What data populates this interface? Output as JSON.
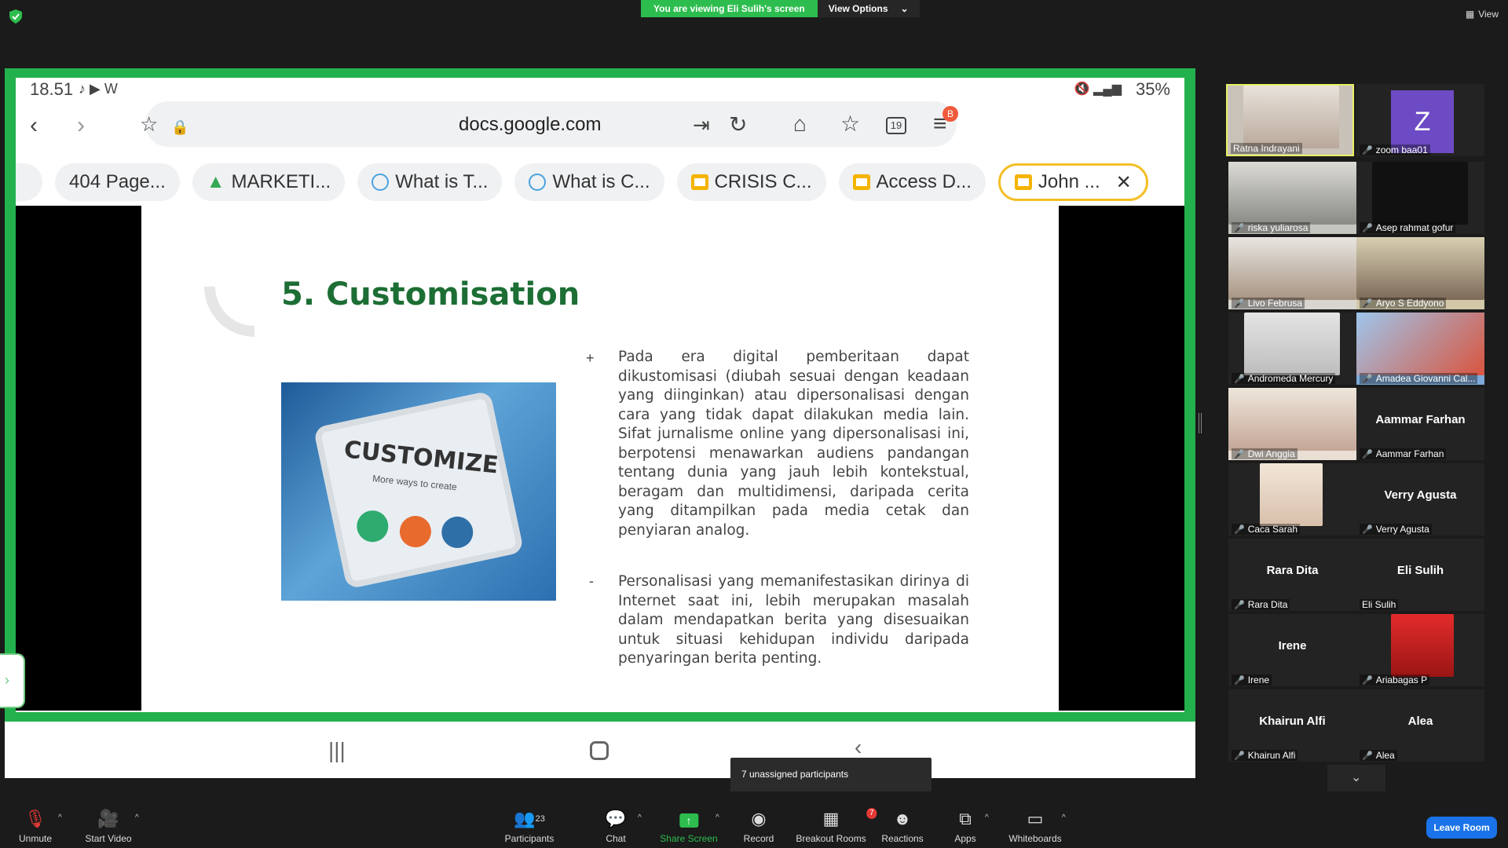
{
  "top": {
    "banner_text": "You are viewing Eli Sulih's screen",
    "view_options": "View Options",
    "view_label": "View"
  },
  "phone": {
    "time": "18.51",
    "battery": "35%",
    "url": "docs.google.com",
    "tabs": [
      {
        "label": "404 Page..."
      },
      {
        "label": "MARKETI..."
      },
      {
        "label": "What is T..."
      },
      {
        "label": "What is C..."
      },
      {
        "label": "CRISIS C..."
      },
      {
        "label": "Access D..."
      },
      {
        "label": "John ..."
      }
    ],
    "menu_badge": "B",
    "tab_count": "19"
  },
  "slide": {
    "title": "5. Customisation",
    "image_text": "CUSTOMIZE",
    "image_subtext": "More ways to create",
    "bullet1": "+",
    "para1": "Pada era digital pemberitaan dapat dikustomisasi (diubah sesuai dengan keadaan yang diinginkan) atau dipersonalisasi dengan cara yang tidak dapat dilakukan media lain. Sifat jurnalisme online yang dipersonalisasi ini, berpotensi menawarkan audiens pandangan tentang dunia yang jauh lebih kontekstual, beragam dan multidimensi, daripada cerita yang ditampilkan pada media cetak dan penyiaran analog.",
    "bullet2": "-",
    "para2": "Personalisasi yang memanifestasikan dirinya di Internet saat ini, lebih merupakan masalah dalam mendapatkan berita yang disesuaikan untuk situasi kehidupan individu daripada penyaringan berita penting."
  },
  "participants": [
    {
      "name": "Ratna Indrayani",
      "big": ""
    },
    {
      "name": "zoom baa01",
      "big": "Z"
    },
    {
      "name": "riska yuliarosa",
      "big": ""
    },
    {
      "name": "Asep rahmat gofur",
      "big": ""
    },
    {
      "name": "Livo Februsa",
      "big": ""
    },
    {
      "name": "Aryo S Eddyono",
      "big": ""
    },
    {
      "name": "Andromeda Mercury",
      "big": ""
    },
    {
      "name": "Amadea Giovanni Cal...",
      "big": ""
    },
    {
      "name": "Dwi Anggia",
      "big": ""
    },
    {
      "name": "Aammar Farhan",
      "big": "Aammar Farhan"
    },
    {
      "name": "Caca Sarah",
      "big": ""
    },
    {
      "name": "Verry Agusta",
      "big": "Verry Agusta"
    },
    {
      "name": "Rara Dita",
      "big": "Rara Dita"
    },
    {
      "name": "Eli Sulih",
      "big": "Eli Sulih"
    },
    {
      "name": "Irene",
      "big": "Irene"
    },
    {
      "name": "Ariabagas P",
      "big": ""
    },
    {
      "name": "Khairun Alfi",
      "big": "Khairun Alfi"
    },
    {
      "name": "Alea",
      "big": "Alea"
    }
  ],
  "toolbar": {
    "unmute": "Unmute",
    "start_video": "Start Video",
    "participants": "Participants",
    "participants_count": "23",
    "chat": "Chat",
    "share_screen": "Share Screen",
    "record": "Record",
    "breakout_rooms": "Breakout Rooms",
    "breakout_badge": "7",
    "reactions": "Reactions",
    "apps": "Apps",
    "whiteboards": "Whiteboards",
    "leave": "Leave Room",
    "tooltip": "7 unassigned participants"
  },
  "colors": {
    "zoom_green": "#22b14c",
    "slide_title": "#1d6e34",
    "leave_blue": "#1a73e8"
  }
}
